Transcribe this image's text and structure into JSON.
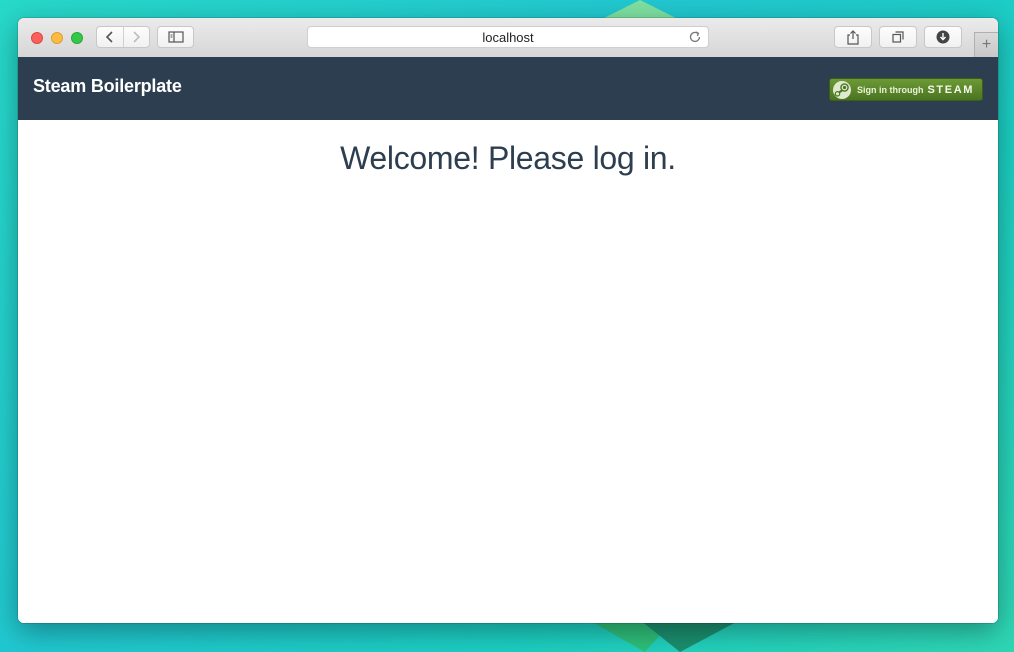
{
  "browser": {
    "address": "localhost",
    "new_tab_symbol": "+",
    "icons": {
      "back": "chevron-left-icon",
      "forward": "chevron-right-icon",
      "sidebar": "sidebar-icon",
      "reload": "reload-icon",
      "share": "share-icon",
      "tabs": "tabs-icon",
      "downloads": "download-icon"
    }
  },
  "navbar": {
    "brand": "Steam Boilerplate",
    "signin_prefix": "Sign in through",
    "signin_brand": "STEAM",
    "background_color": "#2c3e50",
    "signin_color": "#5c8a2c"
  },
  "main": {
    "heading": "Welcome! Please log in."
  }
}
